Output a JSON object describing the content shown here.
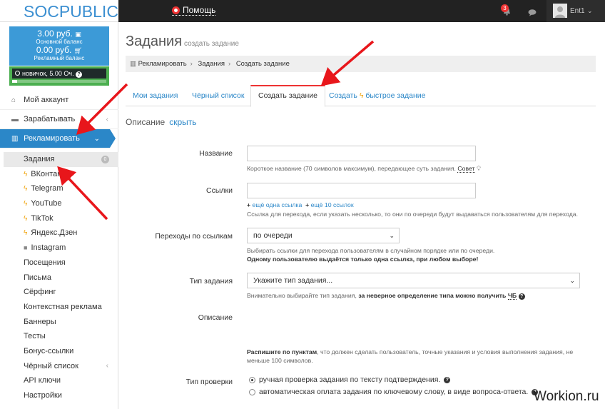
{
  "header": {
    "logo": "SOCPUBLIC",
    "help": "Помощь",
    "notif_count": "3",
    "username": "Ent1"
  },
  "balance": {
    "main_value": "3.00 руб.",
    "main_label": "Основной баланс",
    "ad_value": "0.00 руб.",
    "ad_label": "Рекламный баланс",
    "level": "новичок, 5.00 Оч.",
    "level_progress": 0.05
  },
  "menu": {
    "account": "Мой аккаунт",
    "earn": "Зарабатывать",
    "advertise": "Рекламировать",
    "tasks": "Задания",
    "tasks_count": "0",
    "vk": "ВКонтакте",
    "telegram": "Telegram",
    "youtube": "YouTube",
    "tiktok": "TikTok",
    "dzen": "Яндекс.Дзен",
    "instagram": "Instagram",
    "visits": "Посещения",
    "letters": "Письма",
    "surfing": "Сёрфинг",
    "context": "Контекстная реклама",
    "banners": "Баннеры",
    "tests": "Тесты",
    "bonus": "Бонус-ссылки",
    "blacklist": "Чёрный список",
    "api": "API ключи",
    "settings": "Настройки"
  },
  "page": {
    "title": "Задания",
    "subtitle": "создать задание",
    "breadcrumb": [
      "Рекламировать",
      "Задания",
      "Создать задание"
    ],
    "tabs": [
      "Мои задания",
      "Чёрный список",
      "Создать задание",
      "Создать",
      "быстрое задание"
    ],
    "desc_head": "Описание",
    "hide": "скрыть"
  },
  "form": {
    "name_label": "Название",
    "name_help": "Короткое название (70 символов максимум), передающее суть задания.",
    "tip": "Совет",
    "links_label": "Ссылки",
    "one_more_link": "ещё одна ссылка",
    "ten_more_links": "ещё 10 ссылок",
    "links_help": "Ссылка для перехода, если указать несколько, то они по очереди будут выдаваться пользователям для перехода.",
    "transitions_label": "Переходы по ссылкам",
    "transitions_value": "по очереди",
    "transitions_help": "Выбирать ссылки для перехода пользователям в случайном порядке или по очереди.",
    "transitions_bold": "Одному пользователю выдаётся только одна ссылка, при любом выборе!",
    "type_label": "Тип задания",
    "type_placeholder": "Укажите тип задания...",
    "type_help": "Внимательно выбирайте тип задания,",
    "type_help_bold": "за неверное определение типа можно получить",
    "type_help_link": "ЧБ",
    "desc_label": "Описание",
    "desc_help_bold": "Распишите по пунктам",
    "desc_help": ", что должен сделать пользователь, точные указания и условия выполнения задания, не",
    "desc_help2": "меньше 100 символов.",
    "check_label": "Тип проверки",
    "check_manual": "ручная проверка задания по тексту подтверждения.",
    "check_auto": "автоматическая оплата задания по ключевому слову, в виде вопроса-ответа."
  },
  "watermark": "Workion.ru",
  "colors": {
    "accent": "#2b87c8",
    "arrow": "#e8161b",
    "level_green": "#4caf50"
  }
}
